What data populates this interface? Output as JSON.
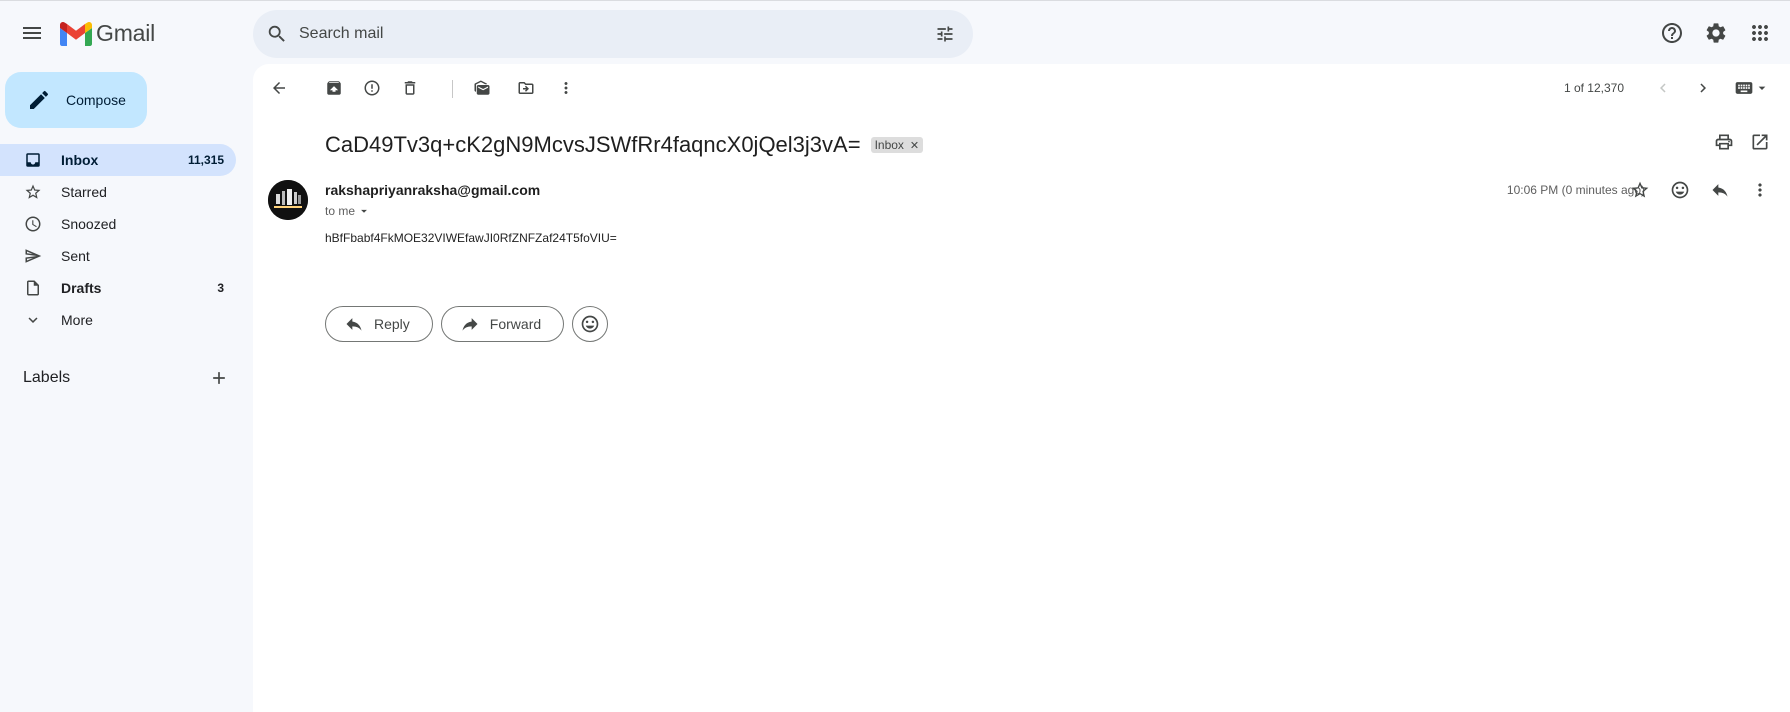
{
  "app": {
    "name": "Gmail"
  },
  "search": {
    "placeholder": "Search mail"
  },
  "compose": {
    "label": "Compose"
  },
  "nav": [
    {
      "label": "Inbox",
      "count": "11,315",
      "icon": "inbox-icon",
      "active": true
    },
    {
      "label": "Starred",
      "count": "",
      "icon": "star-icon"
    },
    {
      "label": "Snoozed",
      "count": "",
      "icon": "clock-icon"
    },
    {
      "label": "Sent",
      "count": "",
      "icon": "send-icon"
    },
    {
      "label": "Drafts",
      "count": "3",
      "icon": "draft-icon",
      "bold": true
    },
    {
      "label": "More",
      "count": "",
      "icon": "chevron-down-icon"
    }
  ],
  "labels": {
    "title": "Labels"
  },
  "pager": {
    "text": "1 of 12,370"
  },
  "email": {
    "subject": "CaD49Tv3q+cK2gN9McvsJSWfRr4faqncX0jQel3j3vA=",
    "label_chip": "Inbox",
    "sender": "rakshapriyanraksha@gmail.com",
    "to": "to me",
    "timestamp": "10:06 PM (0 minutes ago)",
    "body": "hBfFbabf4FkMOE32VIWEfawJI0RfZNFZaf24T5foVIU="
  },
  "actions": {
    "reply": "Reply",
    "forward": "Forward"
  },
  "colors": {
    "accent": "#c2e7ff",
    "active_nav": "#d3e3fd",
    "search_bg": "#e9eef6",
    "page_bg": "#f6f8fc"
  }
}
